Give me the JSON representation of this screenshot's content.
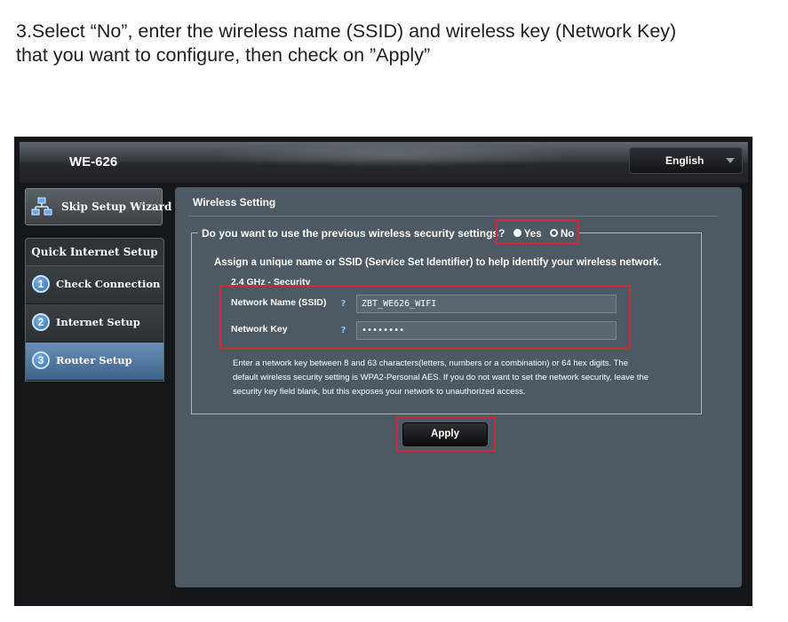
{
  "instruction": {
    "line1": "3.Select “No”, enter the wireless name (SSID) and wireless key (Network Key)",
    "line2": "that you want to configure, then check on ”Apply”"
  },
  "header": {
    "model": "WE-626",
    "language": "English"
  },
  "sidebar": {
    "skip_label": "Skip Setup Wizard",
    "section_title": "Quick Internet Setup",
    "steps": [
      {
        "num": "1",
        "label": "Check Connection",
        "active": false
      },
      {
        "num": "2",
        "label": "Internet Setup",
        "active": false
      },
      {
        "num": "3",
        "label": "Router Setup",
        "active": true
      }
    ]
  },
  "main": {
    "title": "Wireless Setting",
    "question": "Do you want to use the previous wireless security settings?",
    "radio_yes": "Yes",
    "radio_no": "No",
    "radio_selected": "No",
    "assign_text": "Assign a unique name or SSID (Service Set Identifier) to help identify your wireless network.",
    "band": "2.4 GHz - Security",
    "ssid_label": "Network Name (SSID)",
    "ssid_value": "ZBT_WE626_WIFI",
    "key_label": "Network Key",
    "key_value": "••••••••",
    "help_glyph": "?",
    "note_lines": [
      "Enter a network key between 8 and 63 characters(letters, numbers or a combination) or 64 hex digits. The",
      "default wireless security setting is WPA2-Personal AES. If you do not want to set the network security, leave the",
      "security key field blank, but this exposes your network to unauthorized access."
    ],
    "apply_label": "Apply"
  },
  "colors": {
    "highlight": "#cc2a39",
    "panel": "#4d5963",
    "active_step": "#3e638c"
  }
}
